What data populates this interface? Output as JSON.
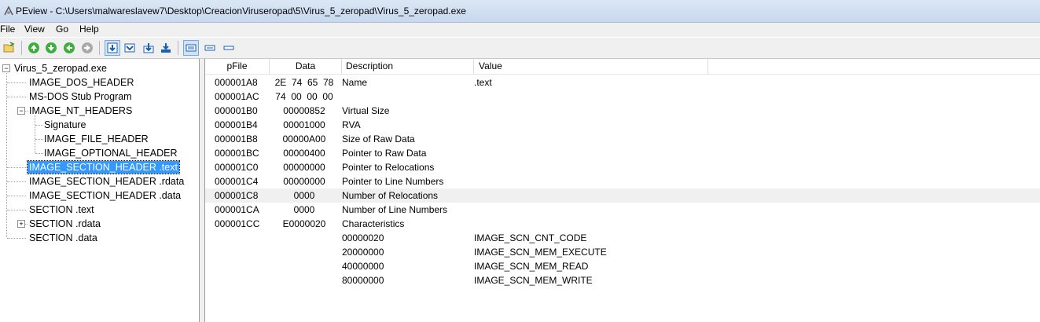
{
  "window": {
    "title": "PEview - C:\\Users\\malwareslavew7\\Desktop\\CreacionViruseropad\\5\\Virus_5_zeropad\\Virus_5_zeropad.exe"
  },
  "menu": [
    "File",
    "View",
    "Go",
    "Help"
  ],
  "toolbar": {
    "icons": [
      "open-icon",
      "back-icon",
      "forward-icon",
      "previous-icon",
      "next-icon",
      "view-hex-icon",
      "view-byte-icon",
      "view-word-icon",
      "view-dword-icon",
      "format-list-icon",
      "format-compact-icon",
      "format-small-icon"
    ]
  },
  "tree": {
    "items": [
      "Virus_5_zeropad.exe",
      "IMAGE_DOS_HEADER",
      "MS-DOS Stub Program",
      "IMAGE_NT_HEADERS",
      "Signature",
      "IMAGE_FILE_HEADER",
      "IMAGE_OPTIONAL_HEADER",
      "IMAGE_SECTION_HEADER .text",
      "IMAGE_SECTION_HEADER .rdata",
      "IMAGE_SECTION_HEADER .data",
      "SECTION .text",
      "SECTION .rdata",
      "SECTION .data"
    ],
    "selected": "IMAGE_SECTION_HEADER .text"
  },
  "table": {
    "headers": [
      "pFile",
      "Data",
      "Description",
      "Value"
    ],
    "rows": [
      {
        "pfile": "000001A8",
        "data": "2E  74  65  78",
        "desc": "Name",
        "value": ".text"
      },
      {
        "pfile": "000001AC",
        "data": "74  00  00  00",
        "desc": "",
        "value": ""
      },
      {
        "pfile": "000001B0",
        "data": "00000852",
        "desc": "Virtual Size",
        "value": ""
      },
      {
        "pfile": "000001B4",
        "data": "00001000",
        "desc": "RVA",
        "value": ""
      },
      {
        "pfile": "000001B8",
        "data": "00000A00",
        "desc": "Size of Raw Data",
        "value": ""
      },
      {
        "pfile": "000001BC",
        "data": "00000400",
        "desc": "Pointer to Raw Data",
        "value": ""
      },
      {
        "pfile": "000001C0",
        "data": "00000000",
        "desc": "Pointer to Relocations",
        "value": ""
      },
      {
        "pfile": "000001C4",
        "data": "00000000",
        "desc": "Pointer to Line Numbers",
        "value": ""
      },
      {
        "pfile": "000001C8",
        "data": "0000",
        "desc": "Number of Relocations",
        "value": ""
      },
      {
        "pfile": "000001CA",
        "data": "0000",
        "desc": "Number of Line Numbers",
        "value": ""
      },
      {
        "pfile": "000001CC",
        "data": "E0000020",
        "desc": "Characteristics",
        "value": ""
      },
      {
        "pfile": "",
        "data": "",
        "desc": "00000020",
        "value": "IMAGE_SCN_CNT_CODE"
      },
      {
        "pfile": "",
        "data": "",
        "desc": "20000000",
        "value": "IMAGE_SCN_MEM_EXECUTE"
      },
      {
        "pfile": "",
        "data": "",
        "desc": "40000000",
        "value": "IMAGE_SCN_MEM_READ"
      },
      {
        "pfile": "",
        "data": "",
        "desc": "80000000",
        "value": "IMAGE_SCN_MEM_WRITE"
      }
    ]
  },
  "colors": {
    "selection": "#3399ff",
    "row_highlight": "#f0f0f0"
  }
}
